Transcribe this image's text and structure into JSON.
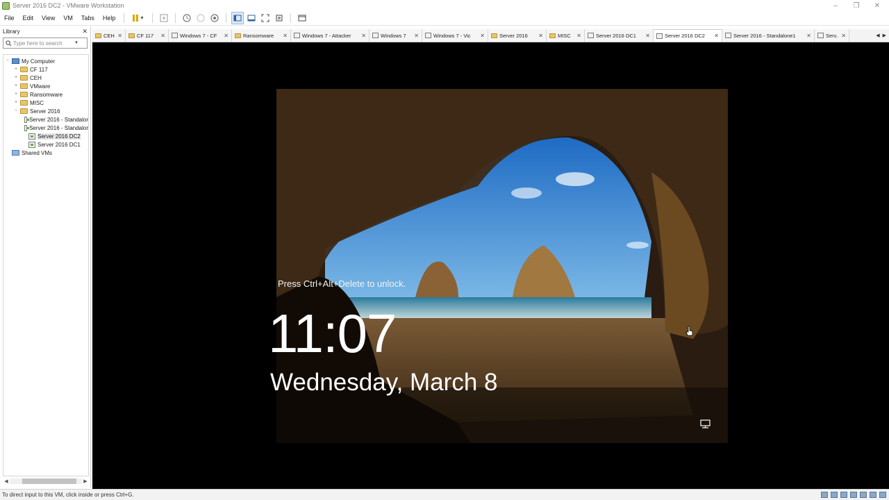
{
  "window": {
    "title": "Server 2016 DC2 - VMware Workstation",
    "controls": {
      "minimize": "–",
      "maximize": "❐",
      "close": "✕"
    }
  },
  "menubar": {
    "items": [
      "File",
      "Edit",
      "View",
      "VM",
      "Tabs",
      "Help"
    ]
  },
  "library": {
    "title": "Library",
    "close": "✕",
    "search_placeholder": "Type here to search",
    "tree": [
      {
        "label": "My Computer",
        "expander": "−",
        "icon": "computer-icon",
        "level": 0
      },
      {
        "label": "CF 117",
        "expander": "+",
        "icon": "folder-icon",
        "level": 1
      },
      {
        "label": "CEH",
        "expander": "+",
        "icon": "folder-icon",
        "level": 1
      },
      {
        "label": "VMware",
        "expander": "+",
        "icon": "folder-icon",
        "level": 1
      },
      {
        "label": "Ransomware",
        "expander": "+",
        "icon": "folder-icon",
        "level": 1
      },
      {
        "label": "MISC",
        "expander": "+",
        "icon": "folder-icon",
        "level": 1
      },
      {
        "label": "Server 2016",
        "expander": "−",
        "icon": "folder-icon",
        "level": 1
      },
      {
        "label": "Server 2016 - Standalor",
        "expander": "",
        "icon": "vm-icon",
        "level": 2
      },
      {
        "label": "Server 2016 - Standalor",
        "expander": "",
        "icon": "vm-icon",
        "level": 2
      },
      {
        "label": "Server 2016 DC2",
        "expander": "",
        "icon": "vm-icon",
        "level": 2,
        "selected": true
      },
      {
        "label": "Server 2016 DC1",
        "expander": "",
        "icon": "vm-icon",
        "level": 2
      },
      {
        "label": "Shared VMs",
        "expander": "",
        "icon": "shared-icon",
        "level": 0
      }
    ],
    "scroll_left": "◀",
    "scroll_right": "▶"
  },
  "tabs": [
    {
      "label": "CEH",
      "icon": "folder",
      "width": 48
    },
    {
      "label": "CF 117",
      "icon": "folder",
      "width": 62
    },
    {
      "label": "Windows 7 - CF",
      "icon": "vm",
      "width": 91
    },
    {
      "label": "Ransomware",
      "icon": "folder",
      "width": 85
    },
    {
      "label": "Windows 7 - Attacker",
      "icon": "vm",
      "width": 113
    },
    {
      "label": "Windows 7",
      "icon": "vm",
      "width": 76
    },
    {
      "label": "Windows 7 - Vic",
      "icon": "vm",
      "width": 95
    },
    {
      "label": "Server 2016",
      "icon": "folder",
      "width": 84
    },
    {
      "label": "MISC",
      "icon": "folder",
      "width": 55
    },
    {
      "label": "Server 2016 DC1",
      "icon": "vm",
      "width": 99
    },
    {
      "label": "Server 2016 DC2",
      "icon": "vm",
      "width": 99,
      "active": true
    },
    {
      "label": "Server 2016 - Standalone1",
      "icon": "vm",
      "width": 133
    },
    {
      "label": "Serv...",
      "icon": "vm",
      "width": 50
    }
  ],
  "tab_nav": {
    "prev": "◀",
    "next": "▶"
  },
  "lockscreen": {
    "prompt": "Press Ctrl+Alt+Delete to unlock.",
    "time": "11:07",
    "date": "Wednesday, March 8"
  },
  "statusbar": {
    "text": "To direct input to this VM, click inside or press Ctrl+G."
  }
}
